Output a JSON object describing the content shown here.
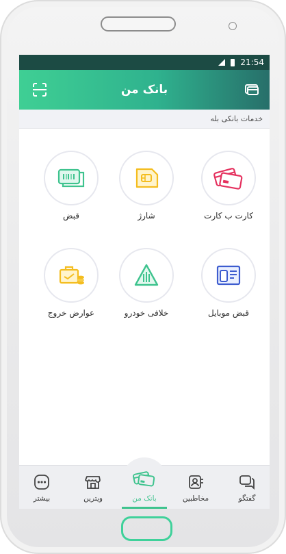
{
  "status_bar": {
    "time": "21:54"
  },
  "app_bar": {
    "title": "بانک من",
    "left_icon": "scan-icon",
    "right_icon": "cards-icon",
    "gradient_colors": [
      "#3fcf94",
      "#2fb28e",
      "#276f6a"
    ]
  },
  "section": {
    "title": "خدمات بانکی بله"
  },
  "services": [
    {
      "label": "کارت ب کارت",
      "icon": "card-to-card-icon"
    },
    {
      "label": "شارژ",
      "icon": "sim-charge-icon"
    },
    {
      "label": "قبض",
      "icon": "bill-icon"
    },
    {
      "label": "قبض موبایل",
      "icon": "mobile-bill-icon"
    },
    {
      "label": "خلافی خودرو",
      "icon": "traffic-warning-icon"
    },
    {
      "label": "عوارض خروج",
      "icon": "exit-toll-icon"
    }
  ],
  "bottom_nav": {
    "items": [
      {
        "label": "گفتگو",
        "icon": "chat-icon"
      },
      {
        "label": "مخاطبین",
        "icon": "contacts-icon"
      },
      {
        "label": "بانک من",
        "icon": "bank-cards-icon",
        "active": true
      },
      {
        "label": "ویترین",
        "icon": "store-icon"
      },
      {
        "label": "بیشتر",
        "icon": "more-icon"
      }
    ],
    "accent": "#3ec38e"
  }
}
